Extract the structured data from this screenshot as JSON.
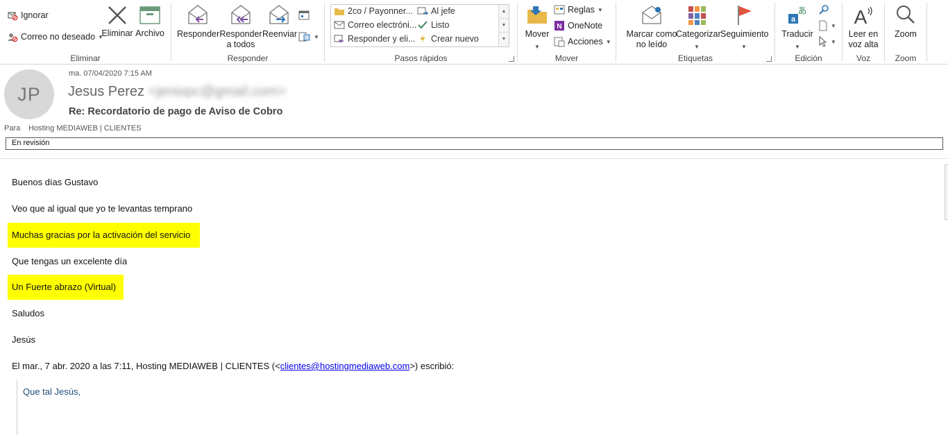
{
  "ribbon": {
    "eliminar_group": {
      "label": "Eliminar",
      "ignorar": "Ignorar",
      "correo_no_deseado": "Correo no deseado",
      "eliminar": "Eliminar",
      "archivo": "Archivo"
    },
    "responder_group": {
      "label": "Responder",
      "responder": "Responder",
      "responder_todos_1": "Responder",
      "responder_todos_2": "a todos",
      "reenviar": "Reenviar"
    },
    "pasos_rapidos_group": {
      "label": "Pasos rápidos",
      "items": [
        "2co / Payonner...",
        "Al jefe",
        "Correo electróni...",
        "Listo",
        "Responder y eli...",
        "Crear nuevo"
      ]
    },
    "mover_group": {
      "label": "Mover",
      "mover": "Mover",
      "reglas": "Reglas",
      "onenote": "OneNote",
      "acciones": "Acciones"
    },
    "etiquetas_group": {
      "label": "Etiquetas",
      "marcar_1": "Marcar como",
      "marcar_2": "no leído",
      "categorizar": "Categorizar",
      "seguimiento": "Seguimiento"
    },
    "edicion_group": {
      "label": "Edición",
      "traducir": "Traducir"
    },
    "voz_group": {
      "label": "Voz",
      "leer_1": "Leer en",
      "leer_2": "voz alta"
    },
    "zoom_group": {
      "label": "Zoom",
      "zoom": "Zoom"
    }
  },
  "message": {
    "avatar_initials": "JP",
    "date": "ma. 07/04/2020 7:15 AM",
    "sender_name": "Jesus Perez",
    "sender_email": "<jeniopc@gmail.com>",
    "subject": "Re: Recordatorio de pago de Aviso de Cobro",
    "to_label": "Para",
    "to_value": "Hosting MEDIAWEB | CLIENTES",
    "status": "En revisión"
  },
  "body": {
    "lines": [
      "Buenos días Gustavo",
      "Veo que al igual que yo te levantas temprano",
      "Muchas gracias por la activación del servicio",
      "Que tengas un excelente día",
      "Un Fuerte abrazo (Virtual)",
      "Saludos",
      "Jesús"
    ],
    "reply_prefix": "El mar., 7 abr. 2020 a las 7:11, Hosting MEDIAWEB | CLIENTES (<",
    "reply_email": "clientes@hostingmediaweb.com",
    "reply_suffix": ">) escribió:",
    "quote": "Que tal Jesús,"
  },
  "colors": {
    "highlight": "#ffff00",
    "link": "#0000ee",
    "quote_text": "#1f4e79",
    "flag_red": "#e0533d",
    "ribbon_blue": "#2e75b6",
    "ribbon_purple": "#7b4fa0"
  },
  "icons": [
    "ignore-icon",
    "junk-icon",
    "delete-x-icon",
    "archive-icon",
    "reply-icon",
    "reply-all-icon",
    "forward-icon",
    "meeting-icon",
    "more-respond-icon",
    "quickstep-icons",
    "move-folder-icon",
    "rules-icon",
    "onenote-icon",
    "actions-icon",
    "mark-unread-icon",
    "categorize-icon",
    "flag-icon",
    "translate-icon",
    "find-icon",
    "select-icon",
    "read-aloud-icon",
    "zoom-icon"
  ]
}
